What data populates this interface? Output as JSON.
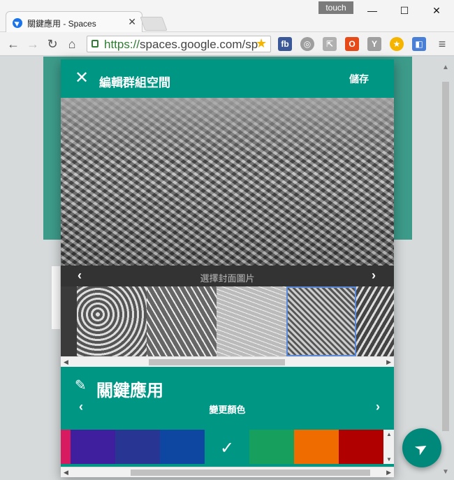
{
  "browser": {
    "tab_title": "關鍵應用 - Spaces",
    "tab_close": "✕",
    "touch_label": "touch",
    "url_secure": "https://",
    "url_host": "spaces.google.com/sp",
    "window_controls": [
      "—",
      "☐",
      "✕"
    ]
  },
  "dialog": {
    "close_glyph": "✕",
    "title": "編輯群組空間",
    "save_label": "儲存",
    "cover_label": "選擇封面圖片",
    "prev_glyph": "‹",
    "next_glyph": "›",
    "group_name": "關鍵應用",
    "edit_glyph": "✎",
    "color_label": "變更顏色",
    "check_glyph": "✓"
  },
  "swatches": [
    {
      "color": "#d81b60"
    },
    {
      "color": "#3f1f9e"
    },
    {
      "color": "#283593"
    },
    {
      "color": "#0d47a1"
    },
    {
      "color": "#009684",
      "selected": true
    },
    {
      "color": "#17a05d"
    },
    {
      "color": "#ef6c00"
    },
    {
      "color": "#b00000"
    }
  ],
  "icons": {
    "fab": "send-icon",
    "header_close": "close-icon",
    "edit": "pencil-icon"
  },
  "colors": {
    "accent": "#009684",
    "fab": "#00897b"
  }
}
